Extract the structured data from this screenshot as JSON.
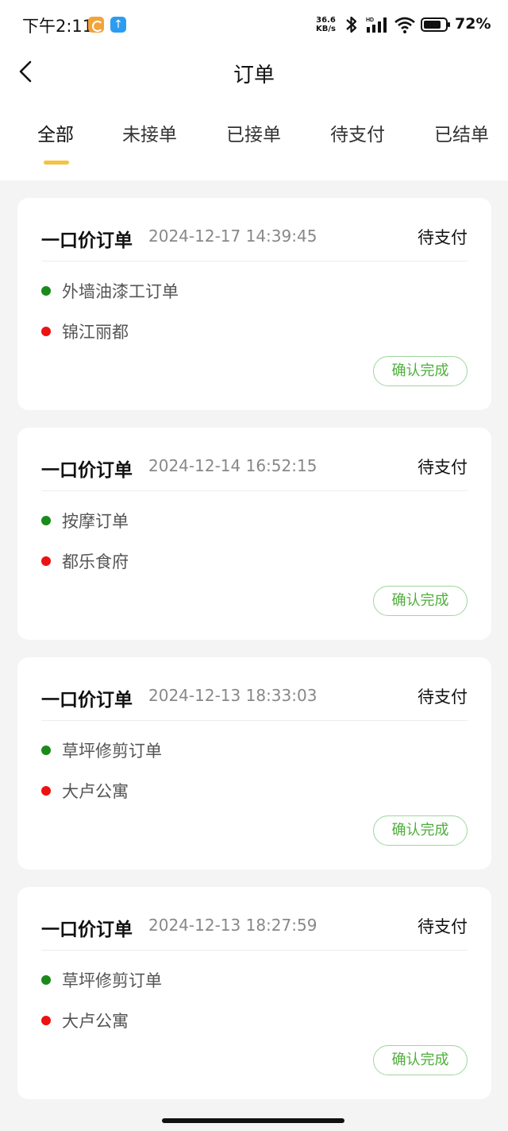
{
  "status_bar": {
    "time": "下午2:11",
    "speed_value": "36.6",
    "speed_unit": "KB/s",
    "signal_tag": "HD",
    "battery_text": "72%",
    "icons": [
      "app-notification-icon",
      "upload-icon",
      "bluetooth-icon",
      "signal-icon",
      "wifi-icon",
      "battery-icon"
    ]
  },
  "header": {
    "title": "订单",
    "back_icon": "chevron-left-icon"
  },
  "tabs": [
    {
      "label": "全部",
      "active": true
    },
    {
      "label": "未接单",
      "active": false
    },
    {
      "label": "已接单",
      "active": false
    },
    {
      "label": "待支付",
      "active": false
    },
    {
      "label": "已结单",
      "active": false
    }
  ],
  "orders": [
    {
      "type": "一口价订单",
      "time": "2024-12-17 14:39:45",
      "status": "待支付",
      "service": "外墙油漆工订单",
      "location": "锦江丽都",
      "action": "确认完成"
    },
    {
      "type": "一口价订单",
      "time": "2024-12-14 16:52:15",
      "status": "待支付",
      "service": "按摩订单",
      "location": "都乐食府",
      "action": "确认完成"
    },
    {
      "type": "一口价订单",
      "time": "2024-12-13 18:33:03",
      "status": "待支付",
      "service": "草坪修剪订单",
      "location": "大卢公寓",
      "action": "确认完成"
    },
    {
      "type": "一口价订单",
      "time": "2024-12-13 18:27:59",
      "status": "待支付",
      "service": "草坪修剪订单",
      "location": "大卢公寓",
      "action": "确认完成"
    }
  ],
  "colors": {
    "accent_tab": "#f3c341",
    "service_dot": "#1a8a1a",
    "location_dot": "#ee1111",
    "confirm_button": "#4fae3b",
    "page_background": "#f4f4f4"
  }
}
